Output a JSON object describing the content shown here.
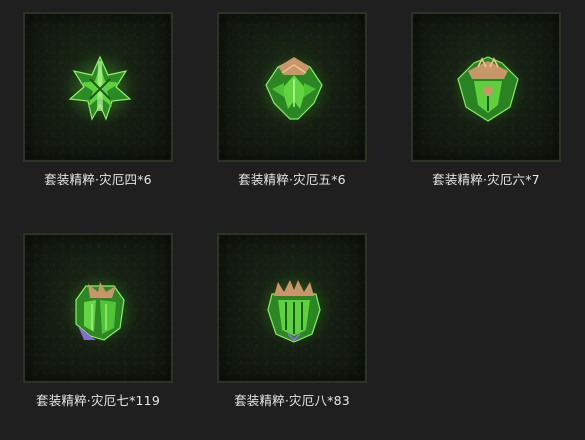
{
  "items": [
    {
      "label": "套装精粹·灾厄四*6",
      "icon": "set-essence-calamity-4-icon"
    },
    {
      "label": "套装精粹·灾厄五*6",
      "icon": "set-essence-calamity-5-icon"
    },
    {
      "label": "套装精粹·灾厄六*7",
      "icon": "set-essence-calamity-6-icon"
    },
    {
      "label": "套装精粹·灾厄七*119",
      "icon": "set-essence-calamity-7-icon"
    },
    {
      "label": "套装精粹·灾厄八*83",
      "icon": "set-essence-calamity-8-icon"
    }
  ],
  "colors": {
    "glow": "#3fbf2f",
    "leaf": "#58c43a",
    "leaf_dark": "#1f6a1a",
    "bronze": "#c9966a",
    "violet": "#8a6bd6"
  }
}
